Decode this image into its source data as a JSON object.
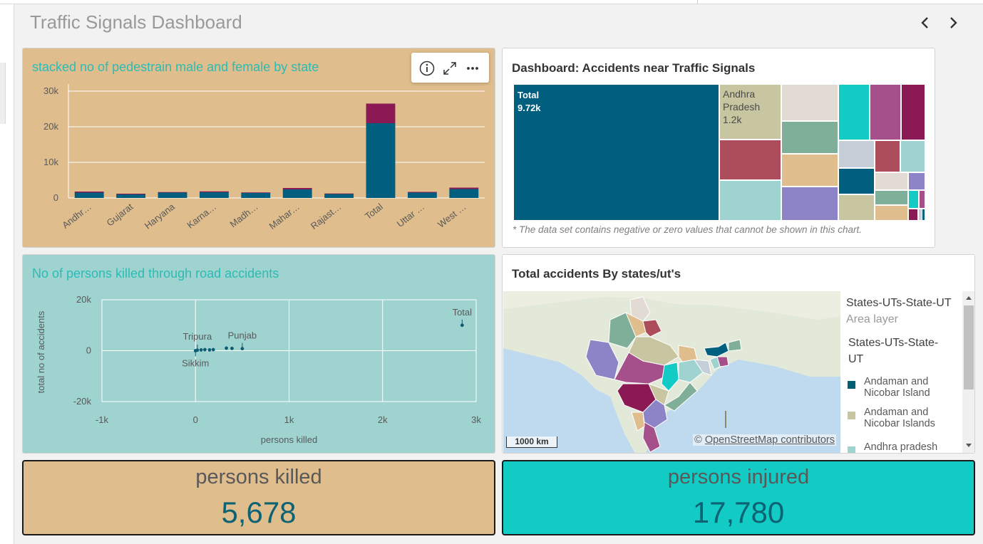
{
  "header": {
    "title": "Traffic Signals Dashboard"
  },
  "bar_panel": {
    "title": "stacked no of pedestrain male and female by state",
    "bg_color": "#dfbd8c",
    "title_color": "#2bbcb5",
    "toolbar": {
      "info_icon": "info-icon",
      "expand_icon": "expand-icon",
      "more_icon": "more-icon"
    }
  },
  "treemap_panel": {
    "title": "Dashboard: Accidents near Traffic Signals",
    "total_label": "Total",
    "total_value": "9.72k",
    "ap_label_1": "Andhra",
    "ap_label_2": "Pradesh",
    "ap_value": "1.2k",
    "note": "* The data set contains negative or zero values that cannot be shown in this chart."
  },
  "scatter_panel": {
    "title": "No of persons killed through road accidents",
    "bg_color": "#9ed3d0",
    "title_color": "#2bbcb5"
  },
  "map_panel": {
    "title": "Total accidents By states/ut's",
    "scale": "1000 km",
    "attribution_symbol": "©",
    "attribution": "OpenStreetMap contributors",
    "legend": {
      "layer_title": "States-UTs-State-UT",
      "layer_sub": "Area layer",
      "field_1": "States-UTs-State-",
      "field_2": "UT",
      "items": [
        {
          "line1": "Andaman and",
          "line2": "Nicobar Island",
          "color": "#005f73"
        },
        {
          "line1": "Andaman and",
          "line2": "Nicobar Islands",
          "color": "#c8c6a0"
        },
        {
          "line1": "Andhra pradesh",
          "line2": "",
          "color": "#9ed3d0"
        }
      ]
    }
  },
  "kpis": {
    "killed": {
      "label": "persons killed",
      "value": "5,678"
    },
    "injured": {
      "label": "persons injured",
      "value": "17,780"
    }
  },
  "chart_data": [
    {
      "type": "bar",
      "title": "stacked no of pedestrain male and female by state",
      "stacked": true,
      "categories": [
        "Andhr…",
        "Gujarat",
        "Haryana",
        "Karna…",
        "Madh…",
        "Mahar…",
        "Rajast…",
        "Total",
        "Uttar …",
        "West …"
      ],
      "series": [
        {
          "values": [
            1500,
            1000,
            1500,
            1600,
            1400,
            2400,
            1100,
            21000,
            1500,
            2500
          ],
          "color": "#005f7f"
        },
        {
          "values": [
            300,
            200,
            150,
            250,
            150,
            400,
            150,
            5500,
            200,
            400
          ],
          "color": "#8b1a54"
        }
      ],
      "ylim": [
        0,
        30000
      ],
      "yticks": [
        0,
        10000,
        20000,
        30000
      ],
      "ytick_labels": [
        "0",
        "10k",
        "20k",
        "30k"
      ],
      "grid": true
    },
    {
      "type": "treemap",
      "title": "Dashboard: Accidents near Traffic Signals",
      "items": [
        {
          "label": "Total",
          "value": 9720,
          "color": "#005f7f"
        },
        {
          "label": "Andhra Pradesh",
          "value": 1200,
          "color": "#c8c6a0"
        }
      ]
    },
    {
      "type": "scatter",
      "title": "No of persons killed through road accidents",
      "xlabel": "persons killed",
      "ylabel": "total no of accidents",
      "xlim": [
        -1000,
        3000
      ],
      "ylim": [
        -20000,
        20000
      ],
      "xticks": [
        -1000,
        0,
        1000,
        2000,
        3000
      ],
      "xtick_labels": [
        "-1k",
        "0",
        "1k",
        "2k",
        "3k"
      ],
      "yticks": [
        -20000,
        0,
        20000
      ],
      "ytick_labels": [
        "-20k",
        "0",
        "20k"
      ],
      "labels": [
        "Tripura",
        "Punjab",
        "Sikkim",
        "Total"
      ],
      "points": [
        {
          "x": 0,
          "y": 0,
          "label": "Sikkim"
        },
        {
          "x": 20,
          "y": 200,
          "label": "Tripura"
        },
        {
          "x": 60,
          "y": 300
        },
        {
          "x": 100,
          "y": 400
        },
        {
          "x": 150,
          "y": 300
        },
        {
          "x": 190,
          "y": 400
        },
        {
          "x": 330,
          "y": 1000
        },
        {
          "x": 390,
          "y": 900
        },
        {
          "x": 500,
          "y": 800,
          "label": "Punjab"
        },
        {
          "x": 2850,
          "y": 10000,
          "label": "Total"
        }
      ]
    }
  ]
}
